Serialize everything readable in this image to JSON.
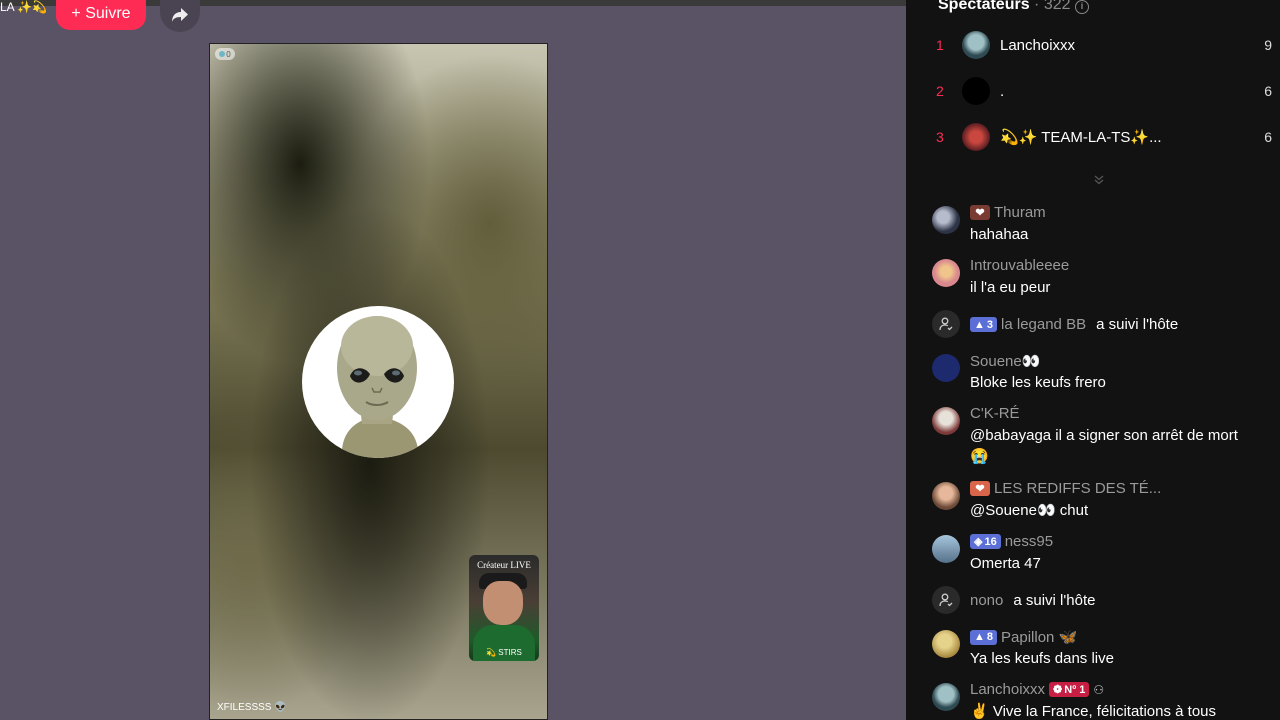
{
  "header": {
    "host_name_fragment": "LA ✨💫",
    "follow_label": "+ Suivre",
    "share_icon": "share-arrow-icon"
  },
  "video": {
    "viewer_badge": "0",
    "creator_label": "Créateur LIVE",
    "creator_shirt_text": "💫 STIRS",
    "username": "XFILESSSS 👽"
  },
  "viewers": {
    "title": "Spectateurs",
    "count": "· 322",
    "top": [
      {
        "rank": "1",
        "name": "Lanchoixxx",
        "score": "9"
      },
      {
        "rank": "2",
        "name": ".",
        "score": "6"
      },
      {
        "rank": "3",
        "name": "💫✨ TEAM-LA-TS✨...",
        "score": "6"
      }
    ]
  },
  "chat": {
    "messages": [
      {
        "user": "Thuram",
        "text": "hahahaa"
      },
      {
        "user": "Introuvableeee",
        "text": "il l'a eu peur"
      },
      {
        "user": "la legand BB",
        "level": "3",
        "action": "a suivi l'hôte"
      },
      {
        "user": "Souene👀",
        "text": "Bloke les keufs frero"
      },
      {
        "user": "C'K-RÉ",
        "text": "@babayaga il a signer son arrêt de mort 😭"
      },
      {
        "user": "LES REDIFFS DES TÉ...",
        "text": "@Souene👀 chut"
      },
      {
        "user": "ness95",
        "level": "16",
        "text": "Omerta 47"
      },
      {
        "user": "nono",
        "action": "a suivi l'hôte"
      },
      {
        "user": "Papillon 🦋",
        "level": "8",
        "text": "Ya les keufs dans live"
      },
      {
        "user": "Lanchoixxx",
        "badge": "Nº 1",
        "text": "✌️ Vive la France, félicitations à tous"
      }
    ]
  },
  "colors": {
    "accent": "#fe2c55",
    "panel_bg": "#121212",
    "page_bg": "#5a5366",
    "level_badge": "#5b6fd6"
  }
}
